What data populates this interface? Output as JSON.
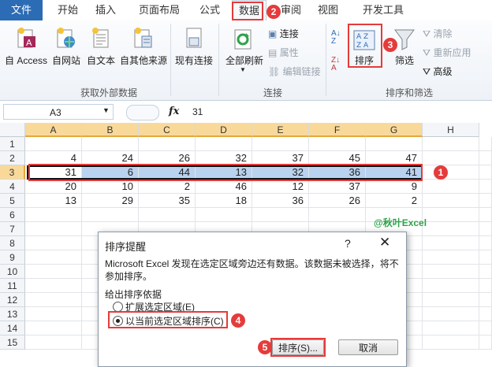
{
  "tabs": [
    "文件",
    "开始",
    "插入",
    "页面布局",
    "公式",
    "数据",
    "审阅",
    "视图",
    "开发工具"
  ],
  "ribbon": {
    "external": {
      "buttons": [
        "自 Access",
        "自网站",
        "自文本",
        "自其他来源",
        "现有连接"
      ],
      "group_label": "获取外部数据"
    },
    "connections": {
      "refresh_all": "全部刷新",
      "items": [
        "连接",
        "属性",
        "编辑链接"
      ],
      "group_label": "连接"
    },
    "sortfilter": {
      "sort_label": "排序",
      "filter_label": "筛选",
      "items": [
        "清除",
        "重新应用",
        "高级"
      ],
      "group_label": "排序和筛选"
    }
  },
  "formula": {
    "name_box": "A3",
    "fx": "fx",
    "value": "31"
  },
  "columns": [
    "A",
    "B",
    "C",
    "D",
    "E",
    "F",
    "G",
    "H"
  ],
  "rows": [
    "1",
    "2",
    "3",
    "4",
    "5",
    "6",
    "7",
    "8",
    "9",
    "10",
    "11",
    "12",
    "13",
    "14",
    "15"
  ],
  "cells": {
    "r2": [
      "4",
      "24",
      "26",
      "32",
      "37",
      "45",
      "47"
    ],
    "r3": [
      "31",
      "6",
      "44",
      "13",
      "32",
      "36",
      "41"
    ],
    "r4": [
      "20",
      "10",
      "2",
      "46",
      "12",
      "37",
      "9"
    ],
    "r5": [
      "13",
      "29",
      "35",
      "18",
      "36",
      "26",
      "2"
    ]
  },
  "watermark": "@秋叶Excel",
  "dialog": {
    "title": "排序提醒",
    "help": "?",
    "close": "✕",
    "message": "Microsoft Excel 发现在选定区域旁边还有数据。该数据未被选择，将不参加排序。",
    "group_label": "给出排序依据",
    "option1": "扩展选定区域(E)",
    "option2": "以当前选定区域排序(C)",
    "sort_button": "排序(S)...",
    "cancel_button": "取消"
  },
  "annotations": [
    "1",
    "2",
    "3",
    "4",
    "5"
  ],
  "colors": {
    "accent_red": "#e53b3b",
    "selection": "#b9d2ef",
    "file_tab": "#2b6cb5"
  }
}
